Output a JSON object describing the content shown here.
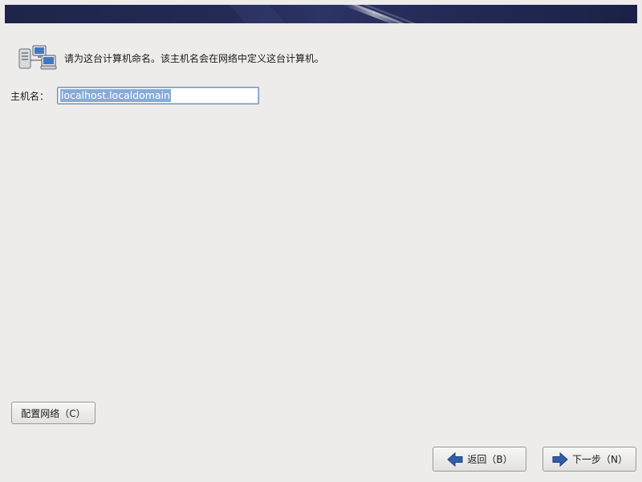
{
  "intro": {
    "icon": "networked-computers-icon",
    "text": "请为这台计算机命名。该主机名会在网络中定义这台计算机。"
  },
  "hostname": {
    "label": "主机名：",
    "value": "localhost.localdomain"
  },
  "buttons": {
    "configure_network": "配置网络（C）",
    "back": "返回（B）",
    "next": "下一步（N）"
  },
  "icons": {
    "back": "arrow-left-icon",
    "next": "arrow-right-icon"
  },
  "colors": {
    "banner": "#232a55",
    "background": "#edeceb",
    "selection": "#86abd9",
    "arrow": "#2f5fa8"
  }
}
